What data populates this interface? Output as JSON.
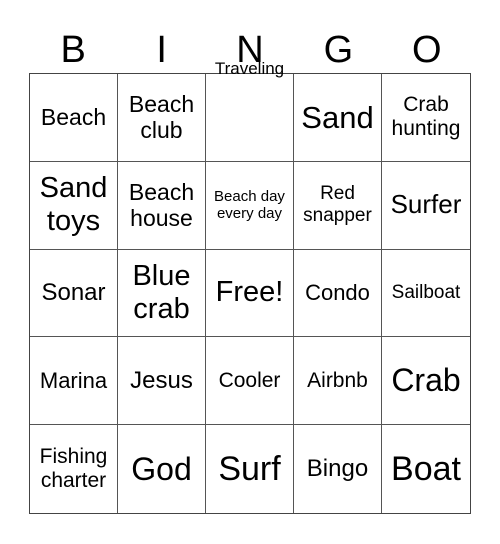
{
  "header": {
    "letters": [
      "B",
      "I",
      "N",
      "G",
      "O"
    ]
  },
  "cells": [
    {
      "text": "Beach",
      "size": 23
    },
    {
      "text": "Beach club",
      "size": 23
    },
    {
      "text": "Traveling",
      "size": 17,
      "overflow": true
    },
    {
      "text": "Sand",
      "size": 31
    },
    {
      "text": "Crab hunting",
      "size": 21
    },
    {
      "text": "Sand toys",
      "size": 29
    },
    {
      "text": "Beach house",
      "size": 23
    },
    {
      "text": "Beach day every day",
      "size": 15
    },
    {
      "text": "Red snapper",
      "size": 19
    },
    {
      "text": "Surfer",
      "size": 26
    },
    {
      "text": "Sonar",
      "size": 24
    },
    {
      "text": "Blue crab",
      "size": 29
    },
    {
      "text": "Free!",
      "size": 29
    },
    {
      "text": "Condo",
      "size": 22
    },
    {
      "text": "Sailboat",
      "size": 19
    },
    {
      "text": "Marina",
      "size": 22
    },
    {
      "text": "Jesus",
      "size": 24
    },
    {
      "text": "Cooler",
      "size": 21
    },
    {
      "text": "Airbnb",
      "size": 21
    },
    {
      "text": "Crab",
      "size": 32
    },
    {
      "text": "Fishing charter",
      "size": 21
    },
    {
      "text": "God",
      "size": 32
    },
    {
      "text": "Surf",
      "size": 34
    },
    {
      "text": "Bingo",
      "size": 24
    },
    {
      "text": "Boat",
      "size": 34
    }
  ]
}
